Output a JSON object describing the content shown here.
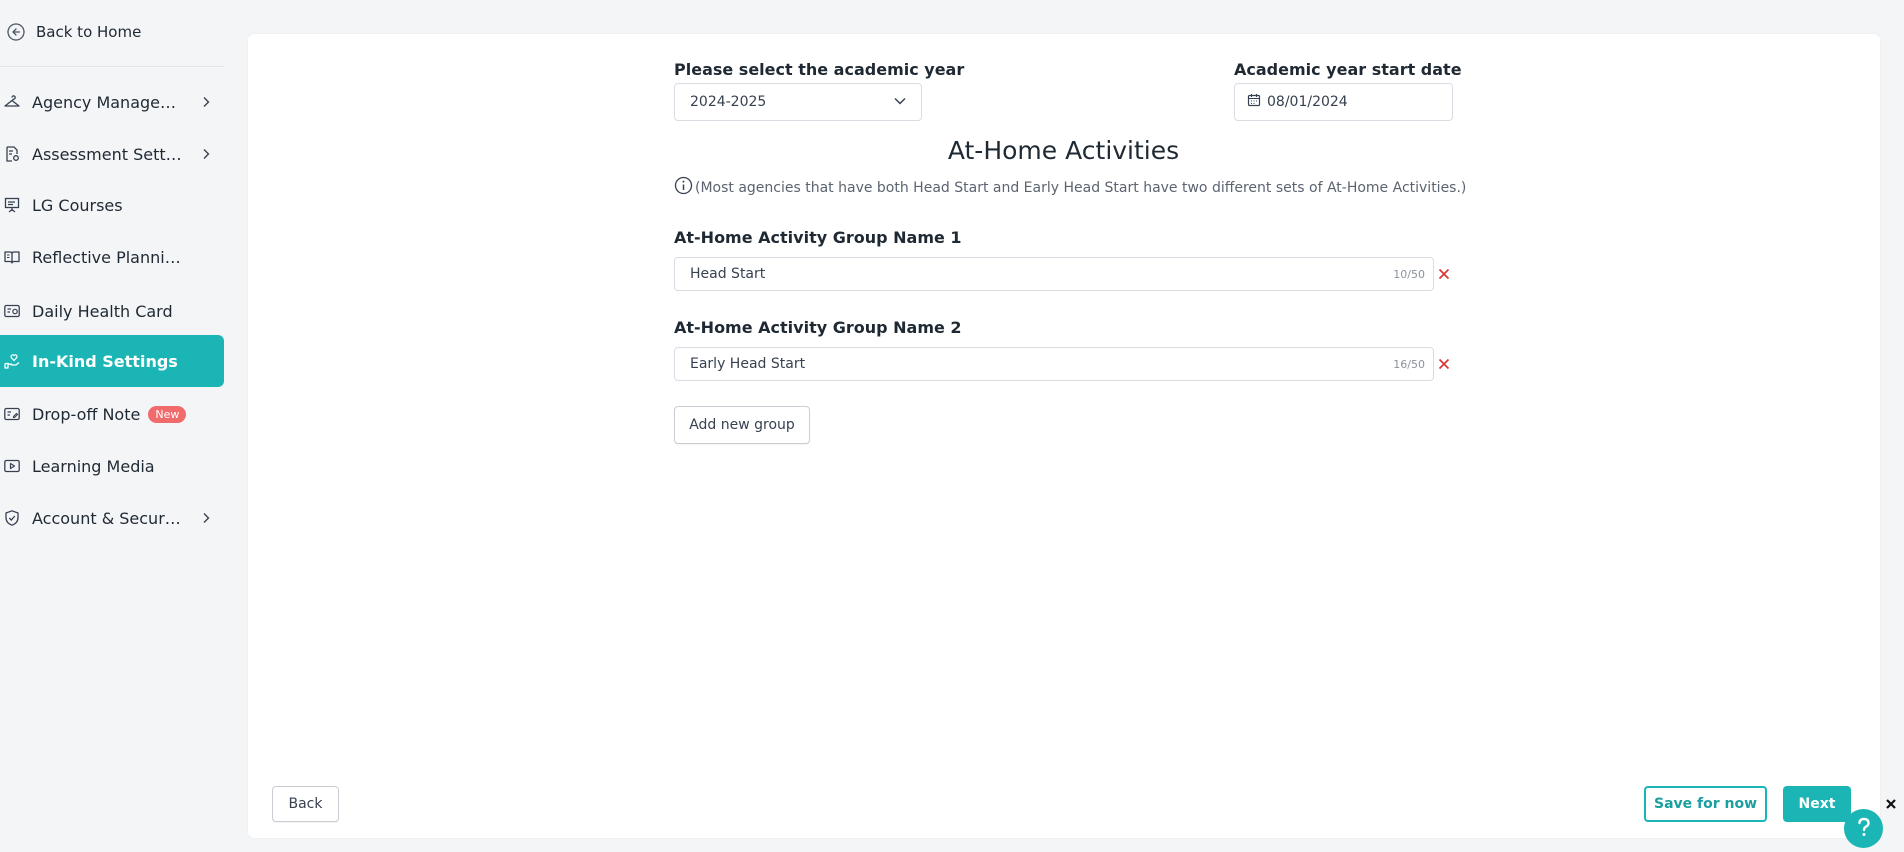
{
  "sidebar": {
    "back_label": "Back to Home",
    "items": [
      {
        "label": "Agency Managem...",
        "icon": "hanger-icon",
        "has_chevron": true
      },
      {
        "label": "Assessment Setti...",
        "icon": "document-gear-icon",
        "has_chevron": true
      },
      {
        "label": "LG Courses",
        "icon": "presentation-board-icon",
        "has_chevron": false
      },
      {
        "label": "Reflective Plannin...",
        "icon": "open-book-icon",
        "has_chevron": false
      },
      {
        "label": "Daily Health Card",
        "icon": "health-card-icon",
        "has_chevron": false
      },
      {
        "label": "In-Kind Settings",
        "icon": "hand-heart-icon",
        "has_chevron": false,
        "active": true
      },
      {
        "label": "Drop-off Note",
        "icon": "note-card-icon",
        "has_chevron": false,
        "badge": "New"
      },
      {
        "label": "Learning Media",
        "icon": "play-video-icon",
        "has_chevron": false
      },
      {
        "label": "Account & Security",
        "icon": "shield-check-icon",
        "has_chevron": true
      }
    ]
  },
  "form": {
    "year_label": "Please select the academic year",
    "year_value": "2024-2025",
    "start_date_label": "Academic year start date",
    "start_date_value": "08/01/2024",
    "section_title": "At-Home Activities",
    "info_text": "(Most agencies that have both Head Start and Early Head Start have two different sets of At-Home Activities.)",
    "groups": [
      {
        "label": "At-Home Activity Group Name 1",
        "value": "Head Start",
        "counter": "10/50"
      },
      {
        "label": "At-Home Activity Group Name 2",
        "value": "Early Head Start",
        "counter": "16/50"
      }
    ],
    "add_group_label": "Add new group"
  },
  "footer": {
    "back_label": "Back",
    "save_label": "Save for now",
    "next_label": "Next"
  },
  "colors": {
    "accent": "#1bb5b5",
    "danger": "#d93636",
    "badge": "#f06b6b"
  }
}
